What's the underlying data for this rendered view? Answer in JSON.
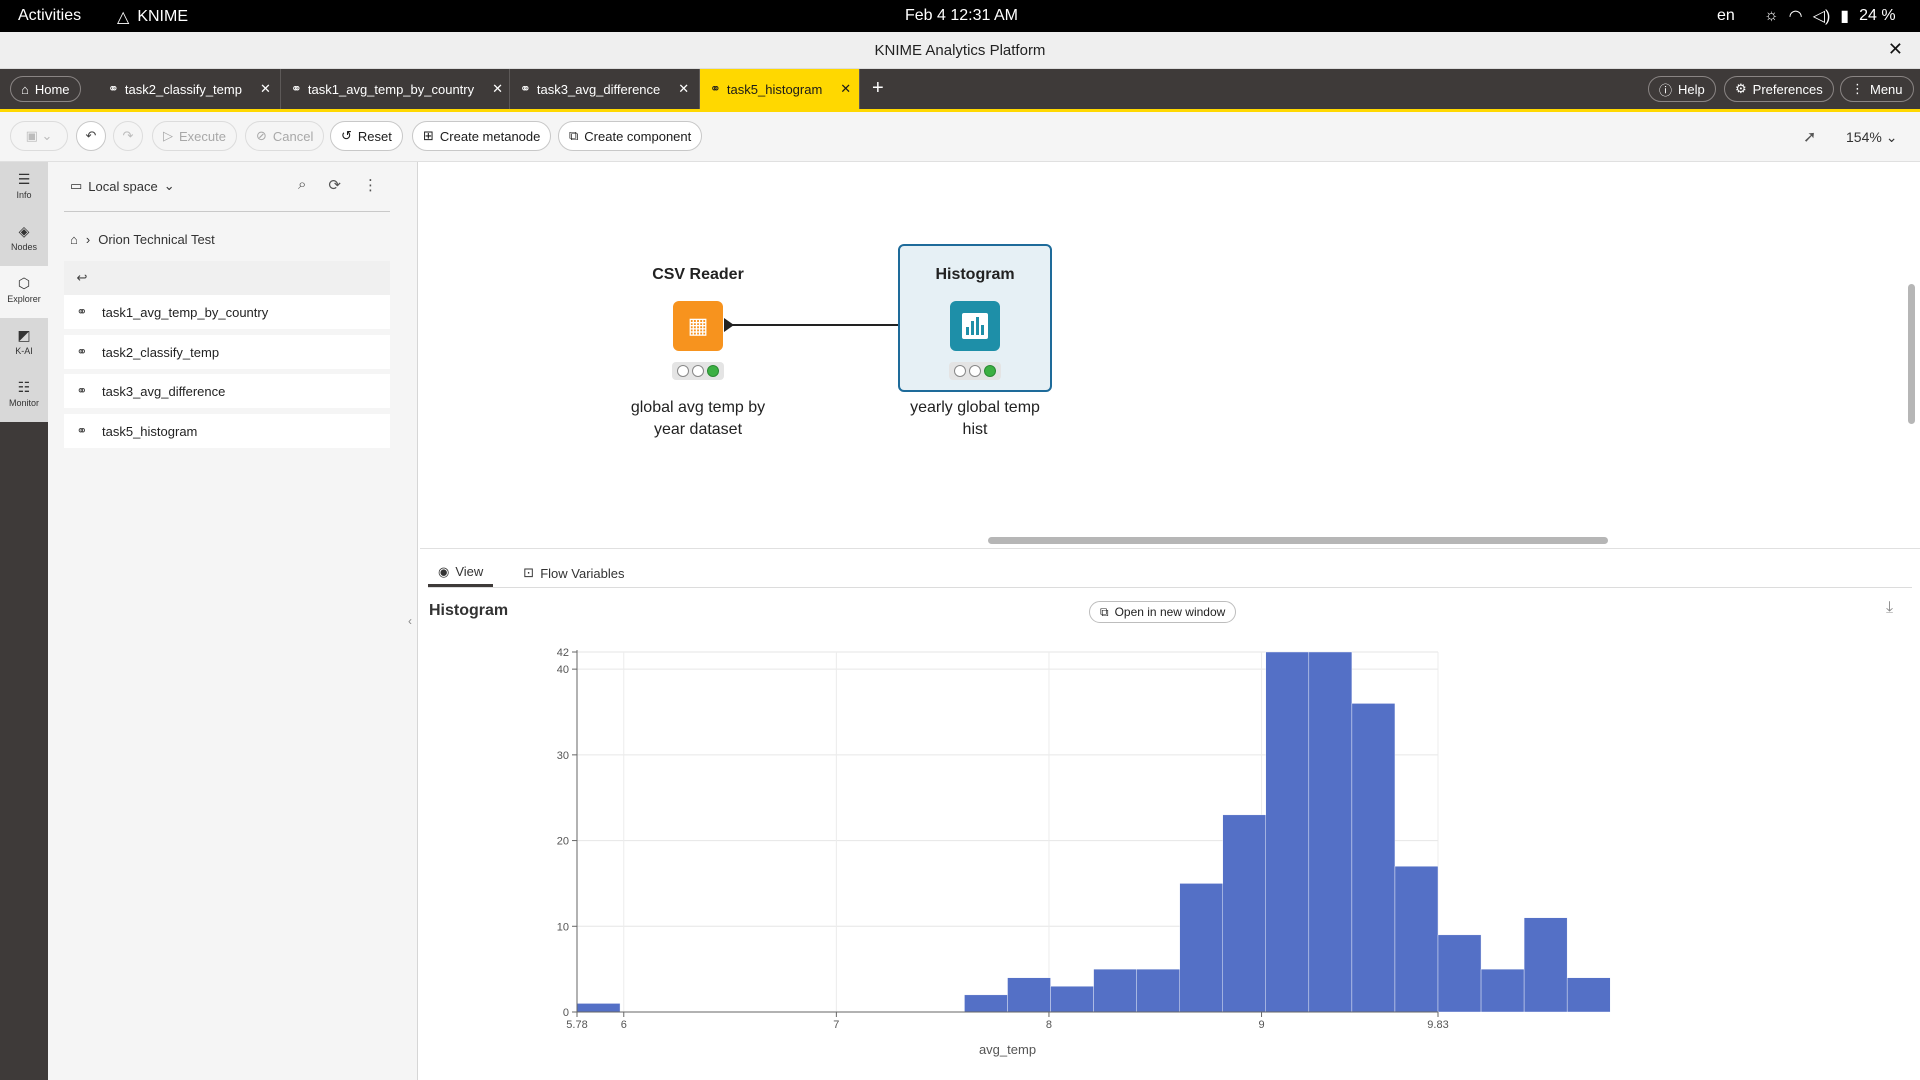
{
  "system": {
    "activities": "Activities",
    "app_name": "KNIME",
    "clock": "Feb 4  12:31 AM",
    "lang": "en",
    "battery": "24 %"
  },
  "window": {
    "title": "KNIME Analytics Platform"
  },
  "tabs": {
    "home": "Home",
    "items": [
      {
        "label": "task2_classify_temp"
      },
      {
        "label": "task1_avg_temp_by_country"
      },
      {
        "label": "task3_avg_difference"
      },
      {
        "label": "task5_histogram"
      }
    ],
    "help": "Help",
    "preferences": "Preferences",
    "menu": "Menu"
  },
  "toolbar": {
    "execute": "Execute",
    "cancel": "Cancel",
    "reset": "Reset",
    "create_metanode": "Create metanode",
    "create_component": "Create component",
    "zoom": "154%"
  },
  "rail": {
    "items": [
      {
        "label": "Info",
        "icon": "info-icon"
      },
      {
        "label": "Nodes",
        "icon": "nodes-icon"
      },
      {
        "label": "Explorer",
        "icon": "explorer-icon"
      },
      {
        "label": "K-AI",
        "icon": "kai-icon"
      },
      {
        "label": "Monitor",
        "icon": "monitor-icon"
      }
    ]
  },
  "explorer": {
    "space": "Local space",
    "breadcrumb": "Orion Technical Test",
    "items": [
      {
        "label": "task1_avg_temp_by_country"
      },
      {
        "label": "task2_classify_temp"
      },
      {
        "label": "task3_avg_difference"
      },
      {
        "label": "task5_histogram"
      }
    ]
  },
  "workflow": {
    "nodes": [
      {
        "title": "CSV Reader",
        "label_line1": "global avg temp by",
        "label_line2": "year dataset",
        "color": "#f7931e"
      },
      {
        "title": "Histogram",
        "label_line1": "yearly global temp",
        "label_line2": "hist",
        "color": "#1e8fa8"
      }
    ]
  },
  "view": {
    "tab_view": "View",
    "tab_flow": "Flow Variables",
    "title": "Histogram",
    "open_window": "Open in new window"
  },
  "chart_data": {
    "type": "bar",
    "title": "",
    "xlabel": "avg_temp",
    "ylabel": "",
    "bar_color": "#5470c6",
    "xlim": [
      5.78,
      9.83
    ],
    "ylim": [
      0,
      42
    ],
    "bin_width": 0.2025,
    "x_ticks": [
      "5.78",
      "6",
      "7",
      "8",
      "9",
      "9.83"
    ],
    "x_tick_values": [
      5.78,
      6,
      7,
      8,
      9,
      9.83
    ],
    "y_ticks": [
      "0",
      "10",
      "20",
      "30",
      "40",
      "42"
    ],
    "y_tick_values": [
      0,
      10,
      20,
      30,
      40,
      42
    ],
    "values": [
      1,
      0,
      0,
      0,
      0,
      0,
      0,
      0,
      0,
      2,
      4,
      3,
      5,
      5,
      15,
      23,
      42,
      42,
      36,
      17,
      9,
      5,
      11,
      4
    ]
  }
}
